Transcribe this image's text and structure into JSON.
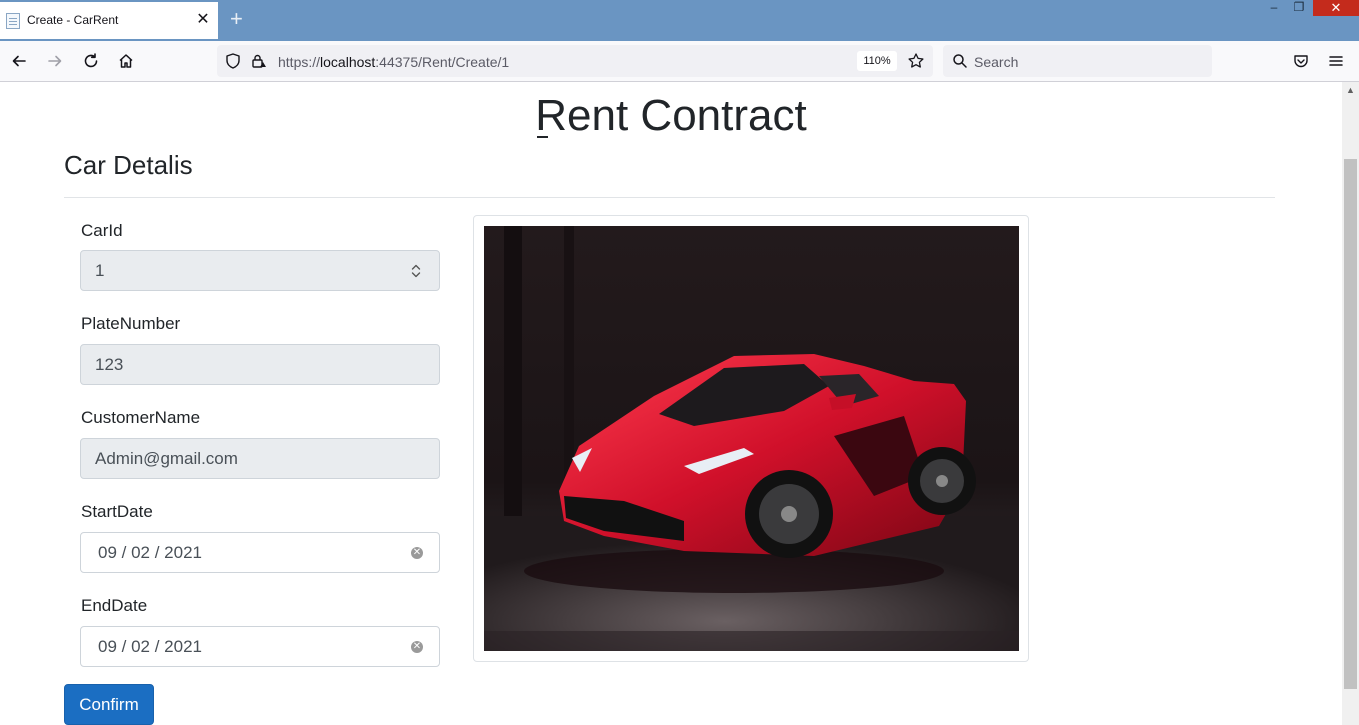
{
  "browser": {
    "tab_title": "Create - CarRent",
    "tab_close": "✕",
    "new_tab": "+",
    "window_controls": {
      "minimize": "–",
      "restore": "❐",
      "close": "✕"
    },
    "url": {
      "prefix": "https://",
      "host": "localhost",
      "rest": ":44375/Rent/Create/1"
    },
    "zoom": "110%",
    "search_placeholder": "Search"
  },
  "page": {
    "title": "Rent Contract",
    "section_title": "Car Detalis"
  },
  "form": {
    "car_id": {
      "label": "CarId",
      "value": "1"
    },
    "plate_number": {
      "label": "PlateNumber",
      "value": "123"
    },
    "customer_name": {
      "label": "CustomerName",
      "value": "Admin@gmail.com"
    },
    "start_date": {
      "label": "StartDate",
      "value": "09 / 02 / 2021"
    },
    "end_date": {
      "label": "EndDate",
      "value": "09 / 02 / 2021"
    },
    "confirm_label": "Confirm"
  },
  "car_image": {
    "subject": "red sports car",
    "icon": "car-photo"
  },
  "colors": {
    "titlebar": "#6a95c2",
    "primary_button": "#1b6ec2",
    "readonly_field": "#e9ecef",
    "car_red": "#d0102a"
  }
}
